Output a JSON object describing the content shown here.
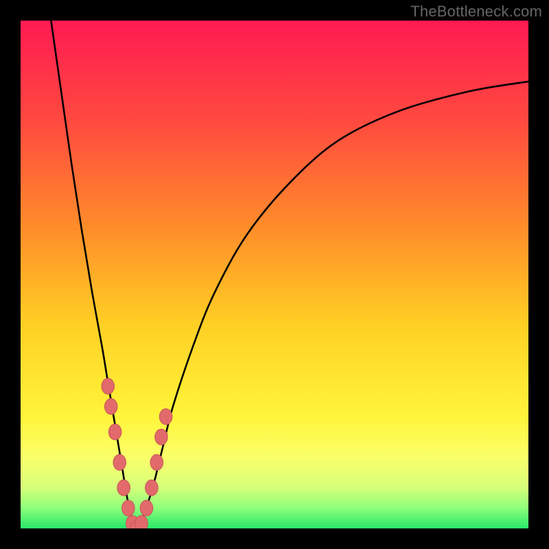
{
  "watermark": "TheBottleneck.com",
  "colors": {
    "frame": "#000000",
    "curve": "#000000",
    "marker_fill": "#e26a6a",
    "marker_stroke": "#c85a5a",
    "gradient_stops": [
      {
        "offset": 0.0,
        "color": "#ff1a52"
      },
      {
        "offset": 0.2,
        "color": "#ff4a3f"
      },
      {
        "offset": 0.4,
        "color": "#ff8a2a"
      },
      {
        "offset": 0.6,
        "color": "#ffd024"
      },
      {
        "offset": 0.78,
        "color": "#fff53a"
      },
      {
        "offset": 0.86,
        "color": "#faff6a"
      },
      {
        "offset": 0.92,
        "color": "#d6ff7a"
      },
      {
        "offset": 0.96,
        "color": "#8dff7a"
      },
      {
        "offset": 1.0,
        "color": "#28e66a"
      }
    ]
  },
  "chart_data": {
    "type": "line",
    "title": "",
    "xlabel": "",
    "ylabel": "",
    "xlim": [
      0,
      100
    ],
    "ylim": [
      0,
      100
    ],
    "series": [
      {
        "name": "bottleneck-curve",
        "x": [
          6,
          8,
          10,
          12,
          14,
          16,
          17,
          18,
          19,
          20,
          21,
          22,
          23,
          24,
          26,
          28,
          30,
          34,
          38,
          44,
          52,
          62,
          74,
          88,
          100
        ],
        "y": [
          100,
          86,
          72,
          59,
          47,
          36,
          30,
          24,
          18,
          12,
          6,
          2,
          0,
          2,
          8,
          16,
          24,
          36,
          46,
          57,
          67,
          76,
          82,
          86,
          88
        ]
      }
    ],
    "markers": {
      "name": "highlighted-points",
      "x": [
        17.2,
        17.8,
        18.6,
        19.5,
        20.3,
        21.2,
        22.0,
        22.9,
        23.8,
        24.8,
        25.8,
        26.8,
        27.7,
        28.6
      ],
      "y": [
        28,
        24,
        19,
        13,
        8,
        4,
        1,
        0,
        1,
        4,
        8,
        13,
        18,
        22
      ]
    }
  }
}
